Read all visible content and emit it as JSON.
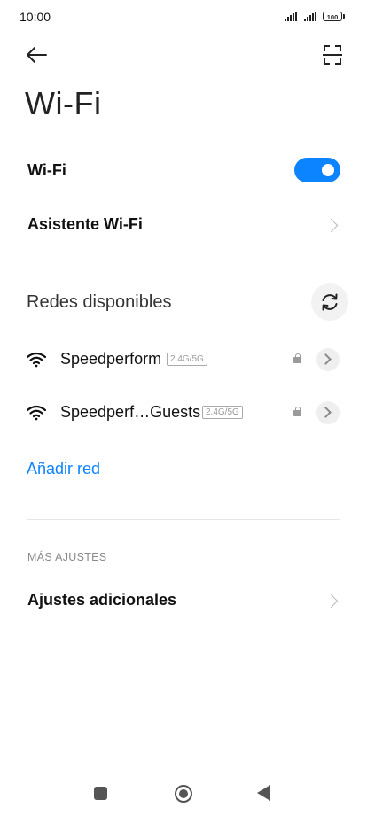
{
  "status_bar": {
    "time": "10:00",
    "battery": "100"
  },
  "header": {
    "title": "Wi-Fi"
  },
  "wifi_toggle": {
    "label": "Wi-Fi",
    "enabled": true
  },
  "assistant": {
    "label": "Asistente Wi-Fi"
  },
  "networks_section": {
    "title": "Redes disponibles"
  },
  "networks": [
    {
      "name": "Speedperform",
      "band": "2.4G/5G",
      "secured": true
    },
    {
      "name": "Speedperf…Guests",
      "band": "2.4G/5G",
      "secured": true
    }
  ],
  "add_network": {
    "label": "Añadir red"
  },
  "more_settings": {
    "section_label": "MÁS AJUSTES",
    "item_label": "Ajustes adicionales"
  },
  "colors": {
    "accent": "#0d84ff"
  },
  "icons": [
    "back-arrow-icon",
    "scan-icon",
    "refresh-icon",
    "wifi-icon",
    "lock-icon",
    "chevron-right-icon"
  ]
}
